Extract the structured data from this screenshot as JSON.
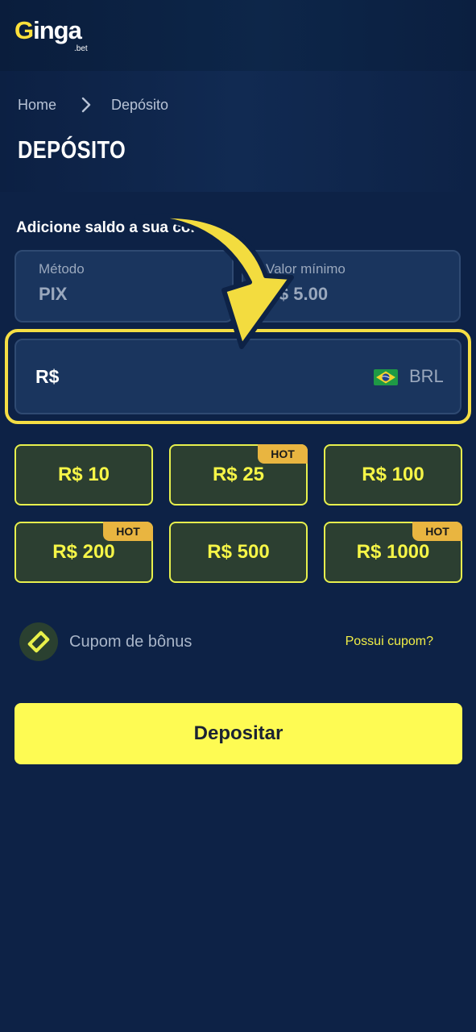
{
  "brand": {
    "logo_main": "inga",
    "logo_letter": "G",
    "logo_sub": ".bet"
  },
  "breadcrumb": {
    "home": "Home",
    "current": "Depósito"
  },
  "page": {
    "title": "DEPÓSITO"
  },
  "form": {
    "intro": "Adicione saldo a sua conta.",
    "method_label": "Método",
    "method_value": "PIX",
    "min_label": "Valor mínimo",
    "min_value": "R$ 5.00",
    "amount_prefix": "R$",
    "amount_value": "",
    "currency": "BRL"
  },
  "quick_amounts": [
    {
      "label": "R$ 10",
      "hot": ""
    },
    {
      "label": "R$ 25",
      "hot": "HOT"
    },
    {
      "label": "R$ 100",
      "hot": ""
    },
    {
      "label": "R$ 200",
      "hot": "HOT"
    },
    {
      "label": "R$ 500",
      "hot": ""
    },
    {
      "label": "R$ 1000",
      "hot": "HOT"
    }
  ],
  "coupon": {
    "label": "Cupom de bônus",
    "link": "Possui cupom?"
  },
  "actions": {
    "deposit": "Depositar"
  },
  "colors": {
    "accent": "#fefb53",
    "background": "#0d2246",
    "hot_badge": "#e9b540"
  }
}
